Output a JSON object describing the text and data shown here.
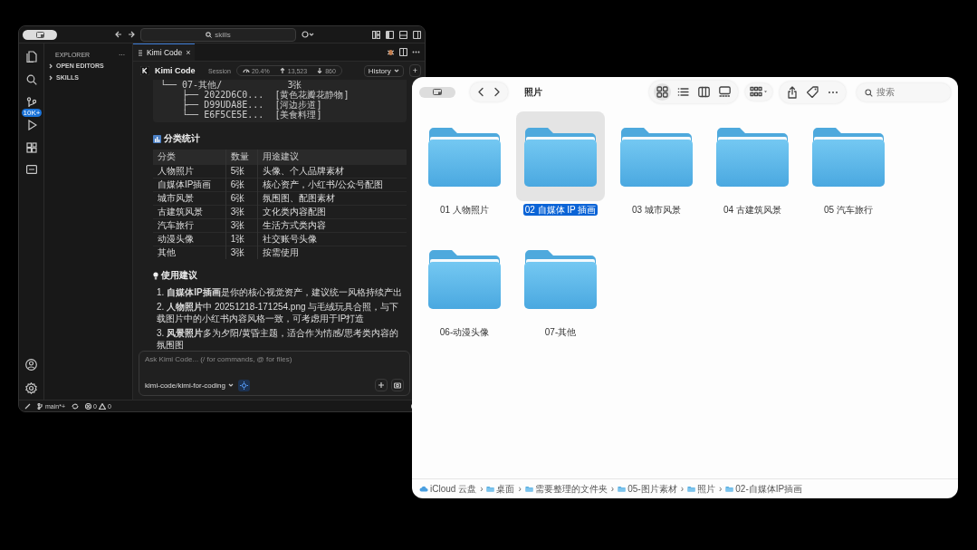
{
  "vscode": {
    "search": "skills",
    "scm_badge": "10K+",
    "sidebar": {
      "title": "EXPLORER",
      "more": "···",
      "sections": [
        {
          "label": "OPEN EDITORS",
          "expanded": false
        },
        {
          "label": "SKILLS",
          "expanded": false
        }
      ]
    },
    "tab": {
      "label": "Kimi Code",
      "close": "×"
    },
    "chat": {
      "title": "Kimi Code",
      "session_label": "Session",
      "stats": [
        {
          "kind": "context",
          "value": "20.4%"
        },
        {
          "kind": "sent",
          "value": "13,523"
        },
        {
          "kind": "received",
          "value": "860"
        }
      ],
      "history_button": "History",
      "new_button": "+",
      "tree_lines": [
        "└── 07-其他/            3张",
        "    ├── 2022D6C0...  [黄色花瓣花静物]",
        "    ├── D99UDA8E...  [河边步道]",
        "    └── E6F5CE5E...  [美食料理]"
      ],
      "stats_heading": "分类统计",
      "table": {
        "columns": [
          "分类",
          "数量",
          "用途建议"
        ],
        "rows": [
          [
            "人物照片",
            "5张",
            "头像、个人品牌素材"
          ],
          [
            "自媒体IP插画",
            "6张",
            "核心资产，小红书/公众号配图"
          ],
          [
            "城市风景",
            "6张",
            "氛围图、配图素材"
          ],
          [
            "古建筑风景",
            "3张",
            "文化类内容配图"
          ],
          [
            "汽车旅行",
            "3张",
            "生活方式类内容"
          ],
          [
            "动漫头像",
            "1张",
            "社交账号头像"
          ],
          [
            "其他",
            "3张",
            "按需使用"
          ]
        ]
      },
      "tips_heading": "使用建议",
      "tips": [
        "1. **自媒体IP插画**是你的核心视觉资产，建议统一风格持续产出",
        "2. **人物照片**中 20251218-171254.png 与毛绒玩具合照，与下载图片中的小红书内容风格一致，可考虑用于IP打造",
        "3. **风景照片**多为夕阳/黄昏主题，适合作为情感/思考类内容的氛围图"
      ],
      "input_placeholder": "Ask Kimi Code... (/ for commands, @ for files)",
      "model": "kimi-code/kimi-for-coding"
    },
    "status_bar": {
      "branch": "main*+",
      "errors": "0",
      "warnings": "0"
    }
  },
  "finder": {
    "title": "照片",
    "search_placeholder": "搜索",
    "views": [
      {
        "kind": "icons",
        "selected": true
      },
      {
        "kind": "list",
        "selected": false
      },
      {
        "kind": "columns",
        "selected": false
      },
      {
        "kind": "gallery",
        "selected": false
      }
    ],
    "folders": [
      {
        "name": "01 人物照片",
        "selected": false
      },
      {
        "name": "02 自媒体 IP 插画",
        "selected": true
      },
      {
        "name": "03 城市风景",
        "selected": false
      },
      {
        "name": "04 古建筑风景",
        "selected": false
      },
      {
        "name": "05 汽车旅行",
        "selected": false
      },
      {
        "name": "06-动漫头像",
        "selected": false
      },
      {
        "name": "07-其他",
        "selected": false
      }
    ],
    "path": [
      {
        "kind": "cloud",
        "label": "iCloud 云盘"
      },
      {
        "kind": "folder",
        "label": "桌面"
      },
      {
        "kind": "folder",
        "label": "需要整理的文件夹"
      },
      {
        "kind": "folder",
        "label": "05-图片素材"
      },
      {
        "kind": "folder",
        "label": "照片"
      },
      {
        "kind": "folder",
        "label": "02-自媒体IP插画"
      }
    ],
    "path_separator": "›"
  }
}
